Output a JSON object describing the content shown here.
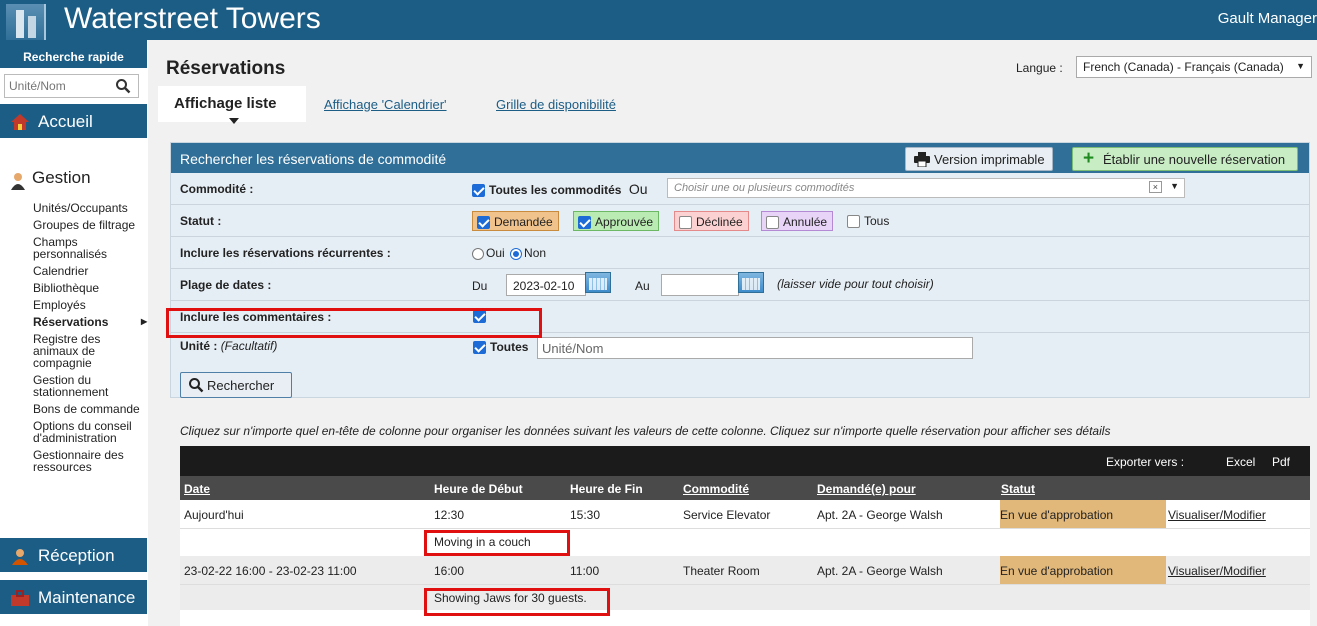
{
  "app": {
    "title": "Waterstreet Towers",
    "user": "Gault Manager"
  },
  "sidebar": {
    "quick_search_title": "Recherche rapide",
    "quick_search_placeholder": "Unité/Nom",
    "sections": {
      "home": "Accueil",
      "management": "Gestion",
      "reception": "Réception",
      "maintenance": "Maintenance"
    },
    "items": [
      "Unités/Occupants",
      "Groupes de filtrage",
      "Champs personnalisés",
      "Calendrier",
      "Bibliothèque",
      "Employés",
      "Réservations",
      "Registre des animaux de compagnie",
      "Gestion du stationnement",
      "Bons de commande",
      "Options du conseil d'administration",
      "Gestionnaire des ressources"
    ]
  },
  "header": {
    "page_title": "Réservations",
    "language_label": "Langue :",
    "language_value": "French (Canada) - Français (Canada)"
  },
  "tabs": [
    "Affichage liste",
    "Affichage 'Calendrier'",
    "Grille de disponibilité"
  ],
  "search_panel": {
    "title": "Rechercher les réservations de commodité",
    "print_button": "Version imprimable",
    "new_button": "Établir une nouvelle réservation",
    "amenity": {
      "label": "Commodité :",
      "all_label": "Toutes les commodités",
      "or": "Ou",
      "placeholder": "Choisir une ou plusieurs commodités",
      "clear": "×"
    },
    "status": {
      "label": "Statut :",
      "requested": "Demandée",
      "approved": "Approuvée",
      "declined": "Déclinée",
      "cancelled": "Annulée",
      "all": "Tous"
    },
    "recurring": {
      "label": "Inclure les réservations récurrentes :",
      "yes": "Oui",
      "no": "Non"
    },
    "dates": {
      "label": "Plage de dates :",
      "from": "Du",
      "from_value": "2023-02-10",
      "to": "Au",
      "to_value": "",
      "hint": "(laisser vide pour tout choisir)"
    },
    "comments": {
      "label": "Inclure les commentaires :"
    },
    "unit": {
      "label": "Unité :",
      "optional": "(Facultatif)",
      "all": "Toutes",
      "placeholder": "Unité/Nom"
    },
    "search_button": "Rechercher"
  },
  "instruction": "Cliquez sur n'importe quel en-tête de colonne pour organiser les données suivant les valeurs de cette colonne. Cliquez sur n'importe quelle réservation pour afficher ses détails",
  "export": {
    "label": "Exporter vers :",
    "excel": "Excel",
    "pdf": "Pdf"
  },
  "table": {
    "headers": {
      "date": "Date",
      "start": "Heure de Début",
      "end": "Heure de Fin",
      "amenity": "Commodité",
      "requested_for": "Demandé(e) pour",
      "status": "Statut"
    },
    "rows": [
      {
        "date": "Aujourd'hui",
        "start": "12:30",
        "end": "15:30",
        "amenity": "Service Elevator",
        "requested_for": "Apt. 2A - George Walsh",
        "status": "En vue d'approbation",
        "action": "Visualiser/Modifier",
        "comment": "Moving in a couch"
      },
      {
        "date": "23-02-22 16:00 - 23-02-23 11:00",
        "start": "16:00",
        "end": "11:00",
        "amenity": "Theater Room",
        "requested_for": "Apt. 2A - George Walsh",
        "status": "En vue d'approbation",
        "action": "Visualiser/Modifier",
        "comment": "Showing Jaws for 30 guests."
      }
    ]
  },
  "colors": {
    "brand": "#1c5d86",
    "panel_header": "#2f6f98",
    "status_pending": "#e2b87a",
    "highlight": "#e01010"
  }
}
